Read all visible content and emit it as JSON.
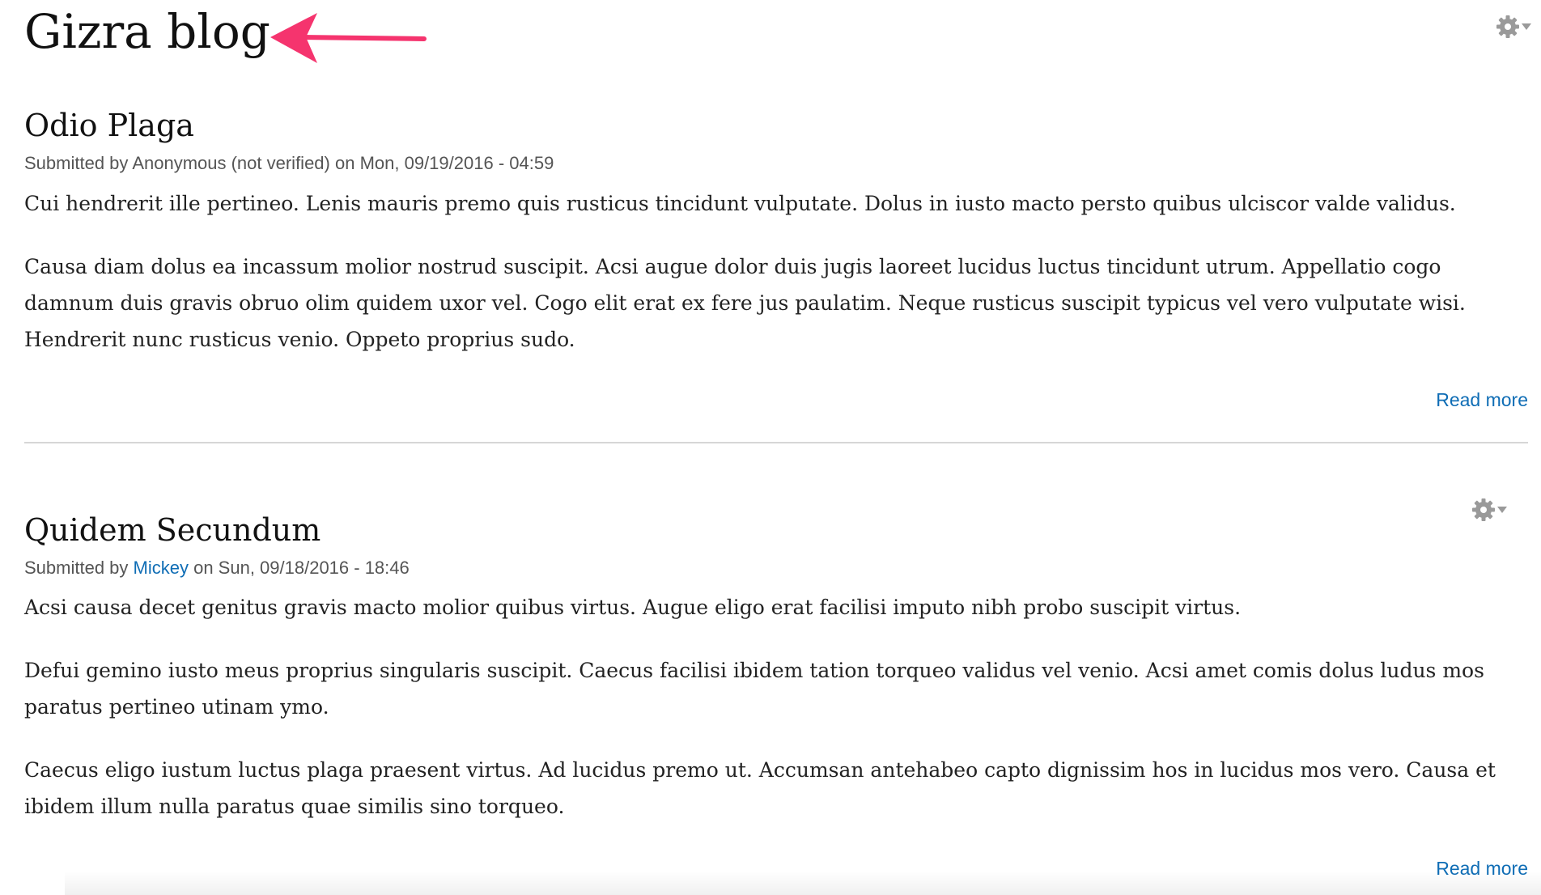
{
  "page_title": "Gizra blog",
  "colors": {
    "link": "#0f6db5",
    "annotation_arrow": "#f5346e",
    "gear": "#9a9a9a",
    "divider": "#d6d6d6",
    "meta_text": "#555555"
  },
  "icons": {
    "page_gear": "gear-icon",
    "post_gear": "gear-icon",
    "annotation": "arrow-left-icon",
    "caret": "caret-down-icon"
  },
  "posts": [
    {
      "title": "Odio Plaga",
      "submitted_prefix": "Submitted by ",
      "author": "Anonymous (not verified)",
      "author_is_link": false,
      "submitted_mid": " on ",
      "date": "Mon, 09/19/2016 - 04:59",
      "paragraphs": [
        "Cui hendrerit ille pertineo. Lenis mauris premo quis rusticus tincidunt vulputate. Dolus in iusto macto persto quibus ulciscor valde validus.",
        "Causa diam dolus ea incassum molior nostrud suscipit. Acsi augue dolor duis jugis laoreet lucidus luctus tincidunt utrum. Appellatio cogo damnum duis gravis obruo olim quidem uxor vel. Cogo elit erat ex fere jus paulatim. Neque rusticus suscipit typicus vel vero vulputate wisi. Hendrerit nunc rusticus venio. Oppeto proprius sudo."
      ],
      "read_more": "Read more"
    },
    {
      "title": "Quidem Secundum",
      "submitted_prefix": "Submitted by ",
      "author": "Mickey",
      "author_is_link": true,
      "submitted_mid": " on ",
      "date": "Sun, 09/18/2016 - 18:46",
      "paragraphs": [
        "Acsi causa decet genitus gravis macto molior quibus virtus. Augue eligo erat facilisi imputo nibh probo suscipit virtus.",
        "Defui gemino iusto meus proprius singularis suscipit. Caecus facilisi ibidem tation torqueo validus vel venio. Acsi amet comis dolus ludus mos paratus pertineo utinam ymo.",
        "Caecus eligo iustum luctus plaga praesent virtus. Ad lucidus premo ut. Accumsan antehabeo capto dignissim hos in lucidus mos vero. Causa et ibidem illum nulla paratus quae similis sino torqueo."
      ],
      "read_more": "Read more"
    }
  ]
}
